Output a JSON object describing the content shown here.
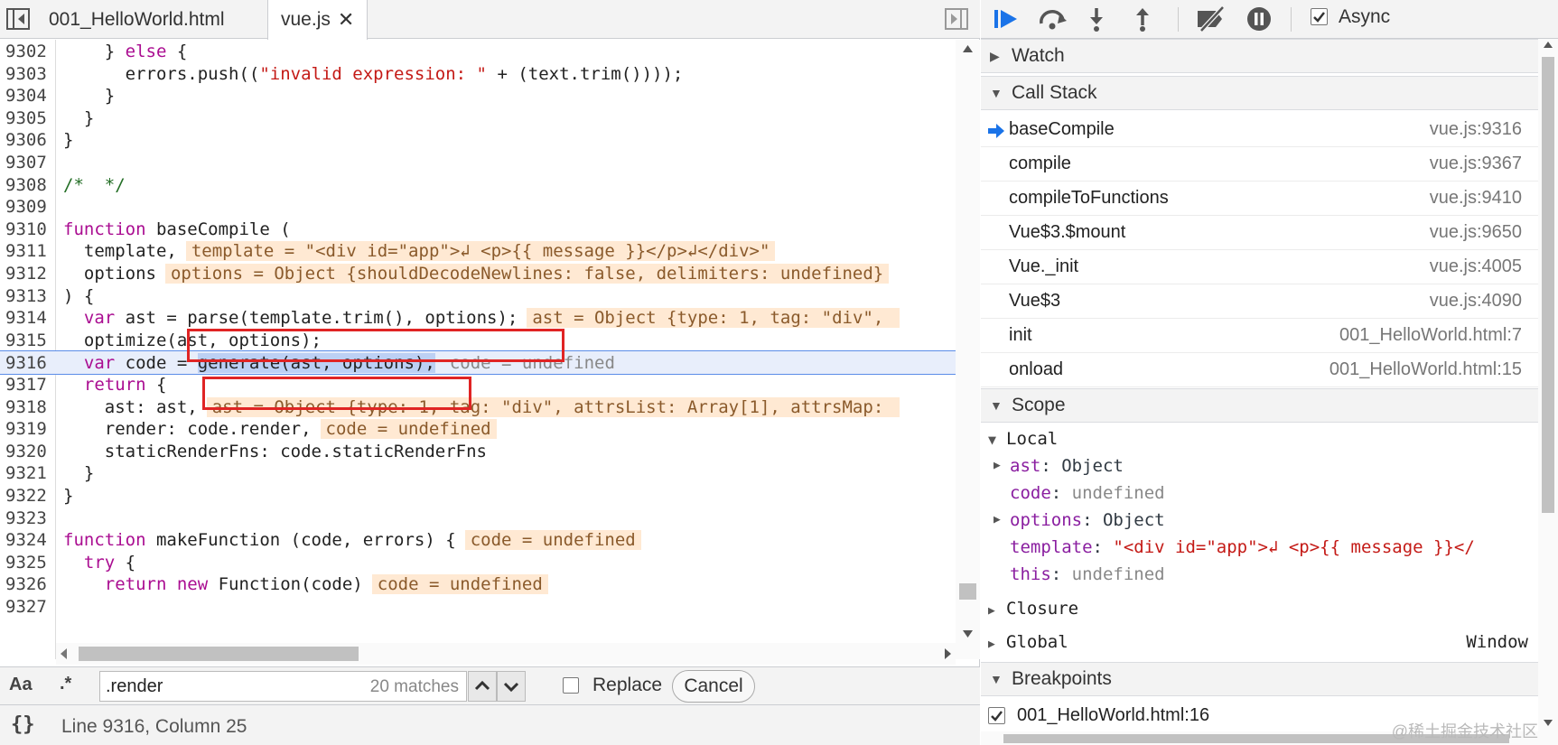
{
  "tabs": [
    {
      "label": "001_HelloWorld.html",
      "active": false
    },
    {
      "label": "vue.js",
      "active": true
    }
  ],
  "code_lines": [
    {
      "n": "9302",
      "html": "    } <span class='kw'>else</span> {"
    },
    {
      "n": "9303",
      "html": "      errors.push((<span class='str'>\"invalid expression: \"</span> + (text.trim())));"
    },
    {
      "n": "9304",
      "html": "    }"
    },
    {
      "n": "9305",
      "html": "  }"
    },
    {
      "n": "9306",
      "html": "}"
    },
    {
      "n": "9307",
      "html": ""
    },
    {
      "n": "9308",
      "html": "<span class='cm'>/*  */</span>"
    },
    {
      "n": "9309",
      "html": ""
    },
    {
      "n": "9310",
      "html": "<span class='kw'>function</span> baseCompile ("
    },
    {
      "n": "9311",
      "html": "  template,<span class='inl'>template = \"&lt;div id=\"app\"&gt;↲ &lt;p&gt;{{ message }}&lt;/p&gt;↲&lt;/div&gt;\"</span>"
    },
    {
      "n": "9312",
      "html": "  options<span class='inl'>options = Object {shouldDecodeNewlines: false, delimiters: undefined}</span>"
    },
    {
      "n": "9313",
      "html": ") {"
    },
    {
      "n": "9314",
      "html": "  <span class='kw'>var</span> ast = parse(template.trim(), options);<span class='inl'>ast = Object {type: 1, tag: \"div\", </span>"
    },
    {
      "n": "9315",
      "html": "  optimize(ast, options);"
    },
    {
      "n": "9316",
      "html": "  <span class='kw'>var</span> code = <span class='sel'>generate(as</span><span class='sel'>t, options);</span><span class='inl cur'>code = undefined</span>",
      "current": true
    },
    {
      "n": "9317",
      "html": "  <span class='kw'>return</span> {"
    },
    {
      "n": "9318",
      "html": "    ast: ast,<span class='inl'>ast = Object {type: 1, tag: \"div\", attrsList: Array[1], attrsMap: </span>"
    },
    {
      "n": "9319",
      "html": "    render: code.render,<span class='inl'>code = undefined</span>"
    },
    {
      "n": "9320",
      "html": "    staticRenderFns: code.staticRenderFns"
    },
    {
      "n": "9321",
      "html": "  }"
    },
    {
      "n": "9322",
      "html": "}"
    },
    {
      "n": "9323",
      "html": ""
    },
    {
      "n": "9324",
      "html": "<span class='kw'>function</span> makeFunction (code, errors) {<span class='inl'>code = undefined</span>"
    },
    {
      "n": "9325",
      "html": "  <span class='kw'>try</span> {"
    },
    {
      "n": "9326",
      "html": "    <span class='kw'>return new</span> Function(code)<span class='inl'>code = undefined</span>"
    },
    {
      "n": "9327",
      "html": ""
    }
  ],
  "search": {
    "match_case": "Aa",
    "regex": ".*",
    "query": ".render",
    "matches": "20 matches",
    "replace_label": "Replace",
    "cancel_label": "Cancel"
  },
  "status": {
    "format_icon": "{}",
    "position": "Line 9316, Column 25"
  },
  "debugger": {
    "async_label": "Async",
    "async_checked": true,
    "watch_label": "Watch",
    "callstack_label": "Call Stack",
    "callstack": [
      {
        "fn": "baseCompile",
        "loc": "vue.js:9316",
        "current": true
      },
      {
        "fn": "compile",
        "loc": "vue.js:9367"
      },
      {
        "fn": "compileToFunctions",
        "loc": "vue.js:9410"
      },
      {
        "fn": "Vue$3.$mount",
        "loc": "vue.js:9650"
      },
      {
        "fn": "Vue._init",
        "loc": "vue.js:4005"
      },
      {
        "fn": "Vue$3",
        "loc": "vue.js:4090"
      },
      {
        "fn": "init",
        "loc": "001_HelloWorld.html:7"
      },
      {
        "fn": "onload",
        "loc": "001_HelloWorld.html:15"
      }
    ],
    "scope_label": "Scope",
    "local_label": "Local",
    "local_vars": [
      {
        "name": "ast",
        "sep": ": ",
        "value": "Object",
        "expandable": true,
        "kind": "obj"
      },
      {
        "name": "code",
        "sep": ": ",
        "value": "undefined",
        "expandable": false,
        "kind": "dim"
      },
      {
        "name": "options",
        "sep": ": ",
        "value": "Object",
        "expandable": true,
        "kind": "obj"
      },
      {
        "name": "template",
        "sep": ": ",
        "value": "\"<div id=\"app\">↲  <p>{{ message }}</",
        "expandable": false,
        "kind": "str"
      },
      {
        "name": "this",
        "sep": ": ",
        "value": "undefined",
        "expandable": false,
        "kind": "dim"
      }
    ],
    "closure_label": "Closure",
    "global_label": "Global",
    "global_value": "Window",
    "breakpoints_label": "Breakpoints",
    "breakpoint": "001_HelloWorld.html:16"
  },
  "watermark": "@稀土掘金技术社区",
  "colors": {
    "accent": "#1a73e8",
    "highlight_box": "#e02424",
    "inline_value_bg": "#ffe9d3"
  }
}
